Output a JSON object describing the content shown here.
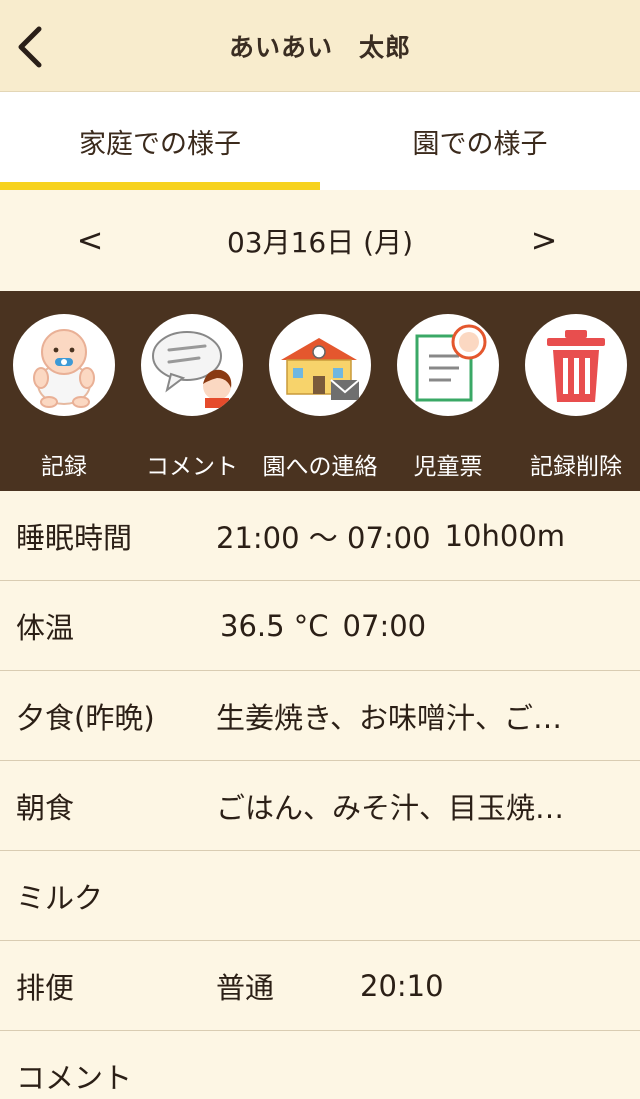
{
  "header": {
    "title": "あいあい　太郎",
    "back_icon": "chevron-left-icon"
  },
  "tabs": [
    {
      "label": "家庭での様子",
      "active": true
    },
    {
      "label": "園での様子",
      "active": false
    }
  ],
  "date_nav": {
    "prev": "<",
    "date": "03月16日 (月)",
    "next": ">"
  },
  "toolbar": [
    {
      "label": "記録",
      "icon": "baby-icon"
    },
    {
      "label": "コメント",
      "icon": "comment-bubble-icon"
    },
    {
      "label": "園への連絡",
      "icon": "school-mail-icon"
    },
    {
      "label": "児童票",
      "icon": "clipboard-icon"
    },
    {
      "label": "記録削除",
      "icon": "trash-icon"
    }
  ],
  "records": {
    "sleep": {
      "label": "睡眠時間",
      "value": "21:00 〜 07:00",
      "extra": "10h00m"
    },
    "temperature": {
      "label": "体温",
      "value": "36.5 °C",
      "extra": "07:00"
    },
    "dinner": {
      "label": "夕食(昨晩)",
      "value": "生姜焼き、お味噌汁、ご…"
    },
    "breakfast": {
      "label": "朝食",
      "value": "ごはん、みそ汁、目玉焼…"
    },
    "milk": {
      "label": "ミルク",
      "value": ""
    },
    "bowel": {
      "label": "排便",
      "value": "普通",
      "time": "20:10"
    },
    "comment": {
      "label": "コメント",
      "value": ""
    }
  },
  "colors": {
    "header_bg": "#f8eccd",
    "tab_indicator": "#f7d21e",
    "toolbar_bg": "#4a3320",
    "page_bg": "#fdf6e4"
  }
}
